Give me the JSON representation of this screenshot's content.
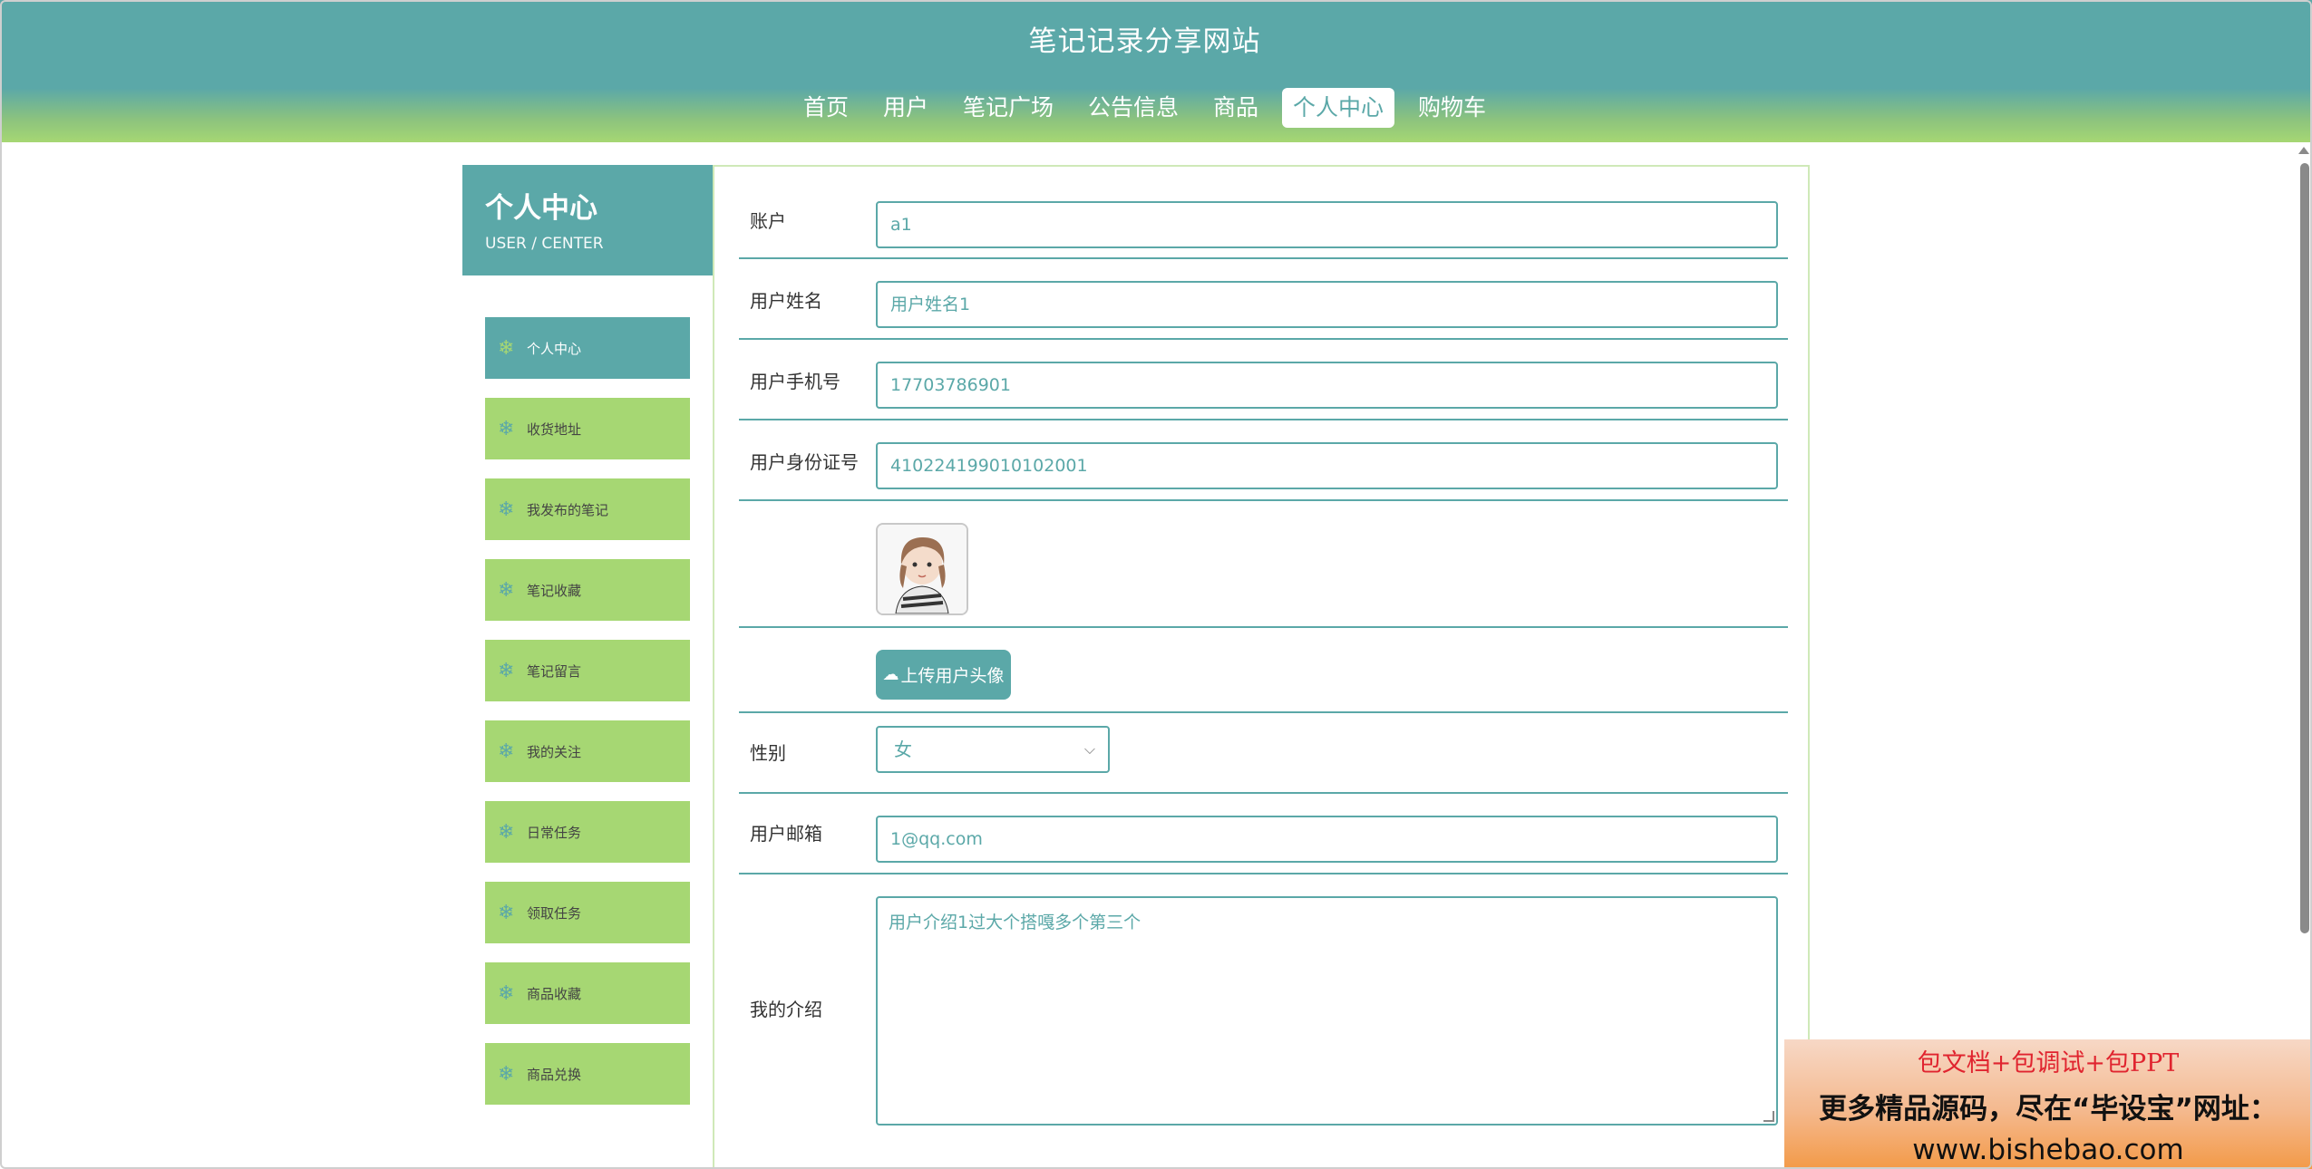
{
  "header": {
    "site_title": "笔记记录分享网站",
    "nav": [
      "首页",
      "用户",
      "笔记广场",
      "公告信息",
      "商品",
      "个人中心",
      "购物车"
    ],
    "active_nav": "个人中心"
  },
  "sidebar": {
    "title": "个人中心",
    "subtitle": "USER / CENTER",
    "items": [
      {
        "label": "个人中心"
      },
      {
        "label": "收货地址"
      },
      {
        "label": "我发布的笔记"
      },
      {
        "label": "笔记收藏"
      },
      {
        "label": "笔记留言"
      },
      {
        "label": "我的关注"
      },
      {
        "label": "日常任务"
      },
      {
        "label": "领取任务"
      },
      {
        "label": "商品收藏"
      },
      {
        "label": "商品兑换"
      }
    ],
    "icon": "❄"
  },
  "form": {
    "account_label": "账户",
    "account_value": "a1",
    "name_label": "用户姓名",
    "name_value": "用户姓名1",
    "phone_label": "用户手机号",
    "phone_value": "17703786901",
    "idcard_label": "用户身份证号",
    "idcard_value": "410224199010102001",
    "upload_label": "上传用户头像",
    "gender_label": "性别",
    "gender_value": "女",
    "email_label": "用户邮箱",
    "email_value": "1@qq.com",
    "intro_label": "我的介绍",
    "intro_value": "用户介绍1过大个搭嘎多个第三个"
  },
  "promo": {
    "line1": "包文档+包调试+包PPT",
    "line2": "更多精品源码，尽在“毕设宝”网址：",
    "line3": "www.bishebao.com"
  },
  "colors": {
    "teal": "#5ba8a8",
    "green": "#a6d773"
  }
}
